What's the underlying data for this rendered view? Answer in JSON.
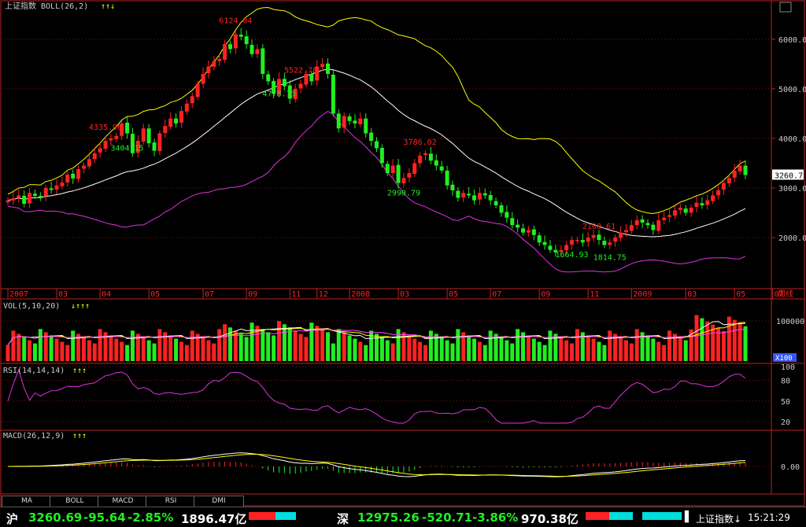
{
  "colors": {
    "up": "#ff2222",
    "down": "#22ee22",
    "mid": "#ffffff",
    "upper": "#ffff00",
    "lower": "#dd33dd",
    "grid": "#8a1010",
    "axis": "#bb2222",
    "label": "#cccccc",
    "ma5": "#ffffff",
    "ma10": "#ffff00",
    "ma20": "#ff44ff",
    "macd_dif": "#ffffff",
    "macd_dea": "#ffff00",
    "highlight": "#3355ff"
  },
  "header": {
    "main_title": "上证指数 BOLL(26,2)",
    "vol_title": "VOL(5,10,20)",
    "rsi_title": "RSI(14,14,14)",
    "macd_title": "MACD(26,12,9)",
    "marker": "↑↑↓",
    "vol_markers": "↓↑↑↑",
    "rsi_markers": "↑↑↑",
    "macd_markers": "↑↑↑"
  },
  "price_axis_labels": [
    "6000.0",
    "5000.0",
    "4000.0",
    "3000.0",
    "2000.0"
  ],
  "current_price": "3260.7",
  "vol_axis_labels": [
    "100000",
    "X100"
  ],
  "rsi_axis_labels": [
    "100",
    "80",
    "50",
    "20"
  ],
  "macd_axis_labels": [
    "0.00"
  ],
  "time_labels": [
    "2007",
    "03",
    "04",
    "05",
    "07",
    "09",
    "11",
    "12",
    "2008",
    "03",
    "05",
    "07",
    "09",
    "11",
    "2009",
    "03",
    "05",
    "07",
    "08",
    "周线"
  ],
  "annotations": [
    {
      "text": "6124.04",
      "type": "high"
    },
    {
      "text": "4335.96",
      "type": "high"
    },
    {
      "text": "3404.15",
      "type": "low"
    },
    {
      "text": "5522.78",
      "type": "high"
    },
    {
      "text": "4778.73",
      "type": "low"
    },
    {
      "text": "3786.02",
      "type": "high"
    },
    {
      "text": "2990.79",
      "type": "low"
    },
    {
      "text": "2100.61",
      "type": "high"
    },
    {
      "text": "1814.75",
      "type": "low"
    },
    {
      "text": "1664.93",
      "type": "low"
    }
  ],
  "tabs": [
    "MA",
    "BOLL",
    "MACD",
    "RSI",
    "DMI"
  ],
  "status": {
    "sh_name": "沪",
    "sh_price": "3260.69",
    "sh_change": "-95.64",
    "sh_pct": "-2.85%",
    "sh_amount": "1896.47亿",
    "sz_name": "深",
    "sz_price": "12975.26",
    "sz_change": "-520.71",
    "sz_pct": "-3.86%",
    "sz_amount": "970.38亿",
    "index_select": "上证指数↓",
    "time": "15:21:29"
  },
  "chart_data": {
    "type": "candlestick",
    "title": "上证指数 BOLL(26,2)",
    "period": "weekly",
    "ylim": [
      1000,
      6600
    ],
    "closes": [
      2750,
      2790,
      2850,
      2680,
      2900,
      2840,
      2820,
      3000,
      2960,
      3050,
      3110,
      3270,
      3190,
      3380,
      3450,
      3580,
      3700,
      3800,
      3950,
      4000,
      4050,
      4300,
      4100,
      3700,
      3950,
      4200,
      3900,
      3750,
      4100,
      4250,
      4400,
      4300,
      4550,
      4700,
      4850,
      5100,
      5300,
      5450,
      5550,
      5600,
      5900,
      5800,
      6100,
      6050,
      5900,
      5700,
      5800,
      5300,
      5150,
      4900,
      5200,
      5050,
      4800,
      5000,
      5100,
      5300,
      5150,
      5450,
      5500,
      5300,
      4500,
      4200,
      4450,
      4350,
      4300,
      4400,
      4100,
      3950,
      3800,
      3500,
      3300,
      3450,
      3100,
      3200,
      3300,
      3500,
      3650,
      3700,
      3550,
      3450,
      3350,
      3050,
      2950,
      2800,
      2900,
      2850,
      2750,
      2900,
      2850,
      2750,
      2650,
      2500,
      2400,
      2250,
      2200,
      2100,
      2150,
      2050,
      1900,
      1850,
      1750,
      1700,
      1750,
      1850,
      1950,
      1950,
      1900,
      2000,
      2050,
      1950,
      1850,
      1900,
      2000,
      2100,
      2150,
      2250,
      2350,
      2300,
      2250,
      2150,
      2350,
      2400,
      2450,
      2550,
      2600,
      2500,
      2600,
      2700,
      2650,
      2750,
      2850,
      2950,
      3100,
      3200,
      3350,
      3450,
      3260.69
    ]
  }
}
